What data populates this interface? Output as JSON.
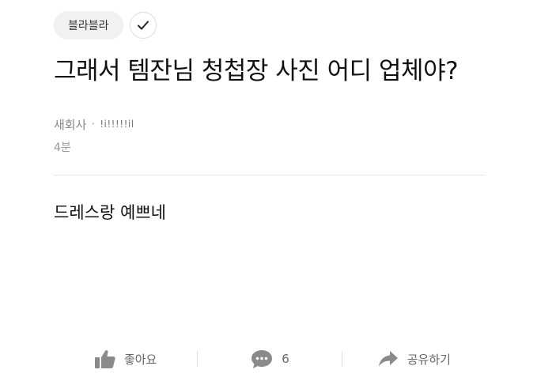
{
  "post": {
    "category": "블라블라",
    "title": "그래서 템잔님 청첩장 사진 어디 업체야?",
    "company": "새회사",
    "author": "!i!!!!!il",
    "time": "4분",
    "body": "드레스랑 예쁘네"
  },
  "actions": {
    "like_label": "좋아요",
    "comment_count": "6",
    "share_label": "공유하기"
  },
  "icons": {
    "check": "check-icon",
    "like": "thumbs-up-icon",
    "comment": "comment-bubble-icon",
    "share": "share-arrow-icon"
  },
  "colors": {
    "icon_gray": "#8a8a8a",
    "chip_bg": "#f1f1f1",
    "divider": "#e5e5e5"
  }
}
